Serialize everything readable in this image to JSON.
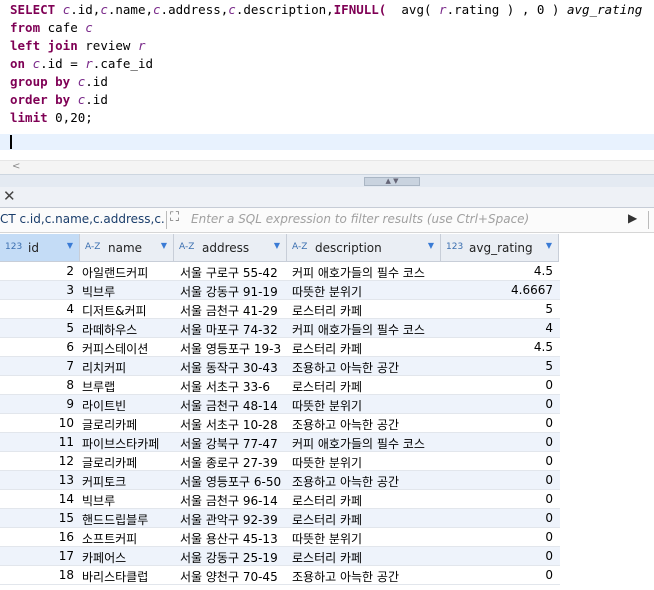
{
  "editor": {
    "lines": [
      {
        "parts": [
          {
            "t": "SELECT ",
            "c": "kw"
          },
          {
            "t": "c",
            "c": "it"
          },
          {
            "t": ".id,",
            "c": "plain"
          },
          {
            "t": "c",
            "c": "it"
          },
          {
            "t": ".name,",
            "c": "plain"
          },
          {
            "t": "c",
            "c": "it"
          },
          {
            "t": ".address,",
            "c": "plain"
          },
          {
            "t": "c",
            "c": "it"
          },
          {
            "t": ".description,",
            "c": "plain"
          },
          {
            "t": "IFNULL(",
            "c": "kw"
          },
          {
            "t": "  avg( ",
            "c": "plain"
          },
          {
            "t": "r",
            "c": "it"
          },
          {
            "t": ".rating ) , 0 ) ",
            "c": "plain"
          },
          {
            "t": "avg_rating",
            "c": "it"
          }
        ]
      },
      {
        "parts": [
          {
            "t": "from ",
            "c": "kw"
          },
          {
            "t": "cafe ",
            "c": "plain"
          },
          {
            "t": "c",
            "c": "it"
          }
        ]
      },
      {
        "parts": [
          {
            "t": "left join ",
            "c": "kw"
          },
          {
            "t": "review ",
            "c": "plain"
          },
          {
            "t": "r",
            "c": "it"
          }
        ]
      },
      {
        "parts": [
          {
            "t": "on ",
            "c": "kw"
          },
          {
            "t": "c",
            "c": "it"
          },
          {
            "t": ".id = ",
            "c": "plain"
          },
          {
            "t": "r",
            "c": "it"
          },
          {
            "t": ".cafe_id",
            "c": "plain"
          }
        ]
      },
      {
        "parts": [
          {
            "t": "group by ",
            "c": "kw"
          },
          {
            "t": "c",
            "c": "it"
          },
          {
            "t": ".id",
            "c": "plain"
          }
        ]
      },
      {
        "parts": [
          {
            "t": "order by ",
            "c": "kw"
          },
          {
            "t": "c",
            "c": "it"
          },
          {
            "t": ".id",
            "c": "plain"
          }
        ]
      },
      {
        "parts": [
          {
            "t": "limit ",
            "c": "kw"
          },
          {
            "t": "0,20;",
            "c": "plain"
          }
        ]
      }
    ]
  },
  "filter": {
    "sql_prefix": "CT c.id,c.name,c.address,c.desc",
    "placeholder": "Enter a SQL expression to filter results (use Ctrl+Space)"
  },
  "columns": [
    {
      "type": "123",
      "name": "id",
      "selected": true
    },
    {
      "type": "A-Z",
      "name": "name",
      "selected": false
    },
    {
      "type": "A-Z",
      "name": "address",
      "selected": false
    },
    {
      "type": "A-Z",
      "name": "description",
      "selected": false
    },
    {
      "type": "123",
      "name": "avg_rating",
      "selected": false
    }
  ],
  "rows": [
    [
      "2",
      "아일랜드커피",
      "서울 구로구 55-42",
      "커피 애호가들의 필수 코스",
      "4.5"
    ],
    [
      "3",
      "빅브루",
      "서울 강동구 91-19",
      "따뜻한 분위기",
      "4.6667"
    ],
    [
      "4",
      "디저트&커피",
      "서울 금천구 41-29",
      "로스터리 카페",
      "5"
    ],
    [
      "5",
      "라떼하우스",
      "서울 마포구 74-32",
      "커피 애호가들의 필수 코스",
      "4"
    ],
    [
      "6",
      "커피스테이션",
      "서울 영등포구 19-3",
      "로스터리 카페",
      "4.5"
    ],
    [
      "7",
      "리치커피",
      "서울 동작구 30-43",
      "조용하고 아늑한 공간",
      "5"
    ],
    [
      "8",
      "브루랩",
      "서울 서초구 33-6",
      "로스터리 카페",
      "0"
    ],
    [
      "9",
      "라이트빈",
      "서울 금천구 48-14",
      "따뜻한 분위기",
      "0"
    ],
    [
      "10",
      "글로리카페",
      "서울 서초구 10-28",
      "조용하고 아늑한 공간",
      "0"
    ],
    [
      "11",
      "파이브스타카페",
      "서울 강북구 77-47",
      "커피 애호가들의 필수 코스",
      "0"
    ],
    [
      "12",
      "글로리카페",
      "서울 종로구 27-39",
      "따뜻한 분위기",
      "0"
    ],
    [
      "13",
      "커피토크",
      "서울 영등포구 6-50",
      "조용하고 아늑한 공간",
      "0"
    ],
    [
      "14",
      "빅브루",
      "서울 금천구 96-14",
      "로스터리 카페",
      "0"
    ],
    [
      "15",
      "핸드드립블루",
      "서울 관악구 92-39",
      "로스터리 카페",
      "0"
    ],
    [
      "16",
      "소프트커피",
      "서울 용산구 45-13",
      "따뜻한 분위기",
      "0"
    ],
    [
      "17",
      "카페어스",
      "서울 강동구 25-19",
      "로스터리 카페",
      "0"
    ],
    [
      "18",
      "바리스타클럽",
      "서울 양천구 70-45",
      "조용하고 아늑한 공간",
      "0"
    ]
  ]
}
